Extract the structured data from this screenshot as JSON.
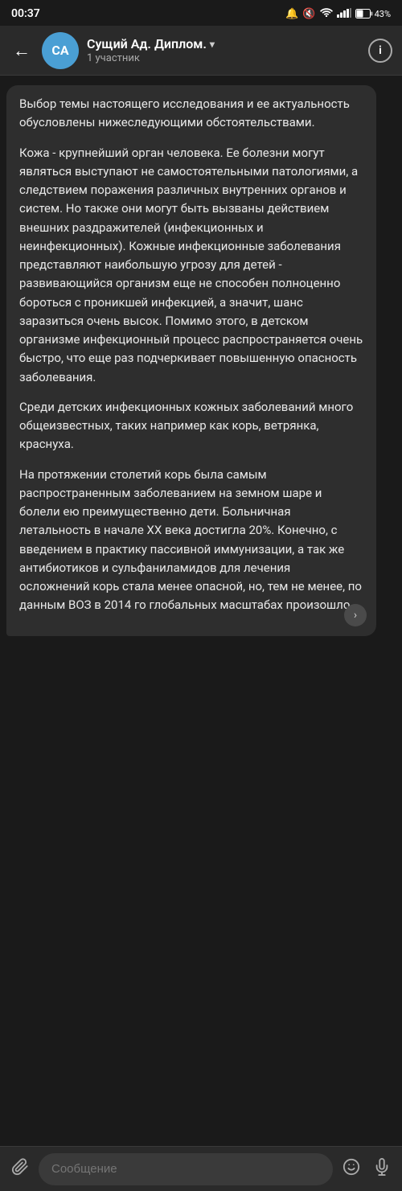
{
  "status_bar": {
    "time": "00:37",
    "icons": [
      "alarm",
      "silent",
      "no_disturb",
      "wifi",
      "signal",
      "battery"
    ],
    "battery_text": "43%"
  },
  "header": {
    "avatar_initials": "CA",
    "title": "Сущий Ад. Диплом.",
    "chevron": "▾",
    "subtitle": "1 участник",
    "back_icon": "←",
    "info_icon": "i"
  },
  "message": {
    "paragraphs": [
      "Выбор темы настоящего исследования и ее актуальность обусловлены нижеследующими обстоятельствами.",
      "Кожа - крупнейший орган человека. Ее болезни могут являться выступают не самостоятельными патологиями, а следствием поражения различных внутренних органов и систем. Но также они могут быть вызваны действием внешних раздражителей (инфекционных и неинфекционных). Кожные инфекционные заболевания представляют наибольшую угрозу для детей - развивающийся организм еще не способен полноценно бороться с проникшей инфекцией, а значит, шанс заразиться очень высок. Помимо этого, в детском организме инфекционный процесс распространяется очень быстро, что еще раз подчеркивает повышенную опасность заболевания.",
      "Среди детских инфекционных кожных заболеваний много общеизвестных, таких например как корь, ветрянка, краснуха.",
      "На протяжении столетий корь была самым распространенным заболеванием на земном шаре и болели ею преимущественно дети. Больничная летальность в начале XX века достигла 20%. Конечно, с введением в практику пассивной иммунизации, а так же антибиотиков и сульфаниламидов для лечения осложнений корь стала менее опасной, но, тем не менее, по данным ВОЗ в 2014 го глобальных масштабах произошло"
    ]
  },
  "input_bar": {
    "placeholder": "Сообщение",
    "attach_icon": "📎",
    "emoji_icon": "🙂",
    "voice_icon": "🎤"
  }
}
